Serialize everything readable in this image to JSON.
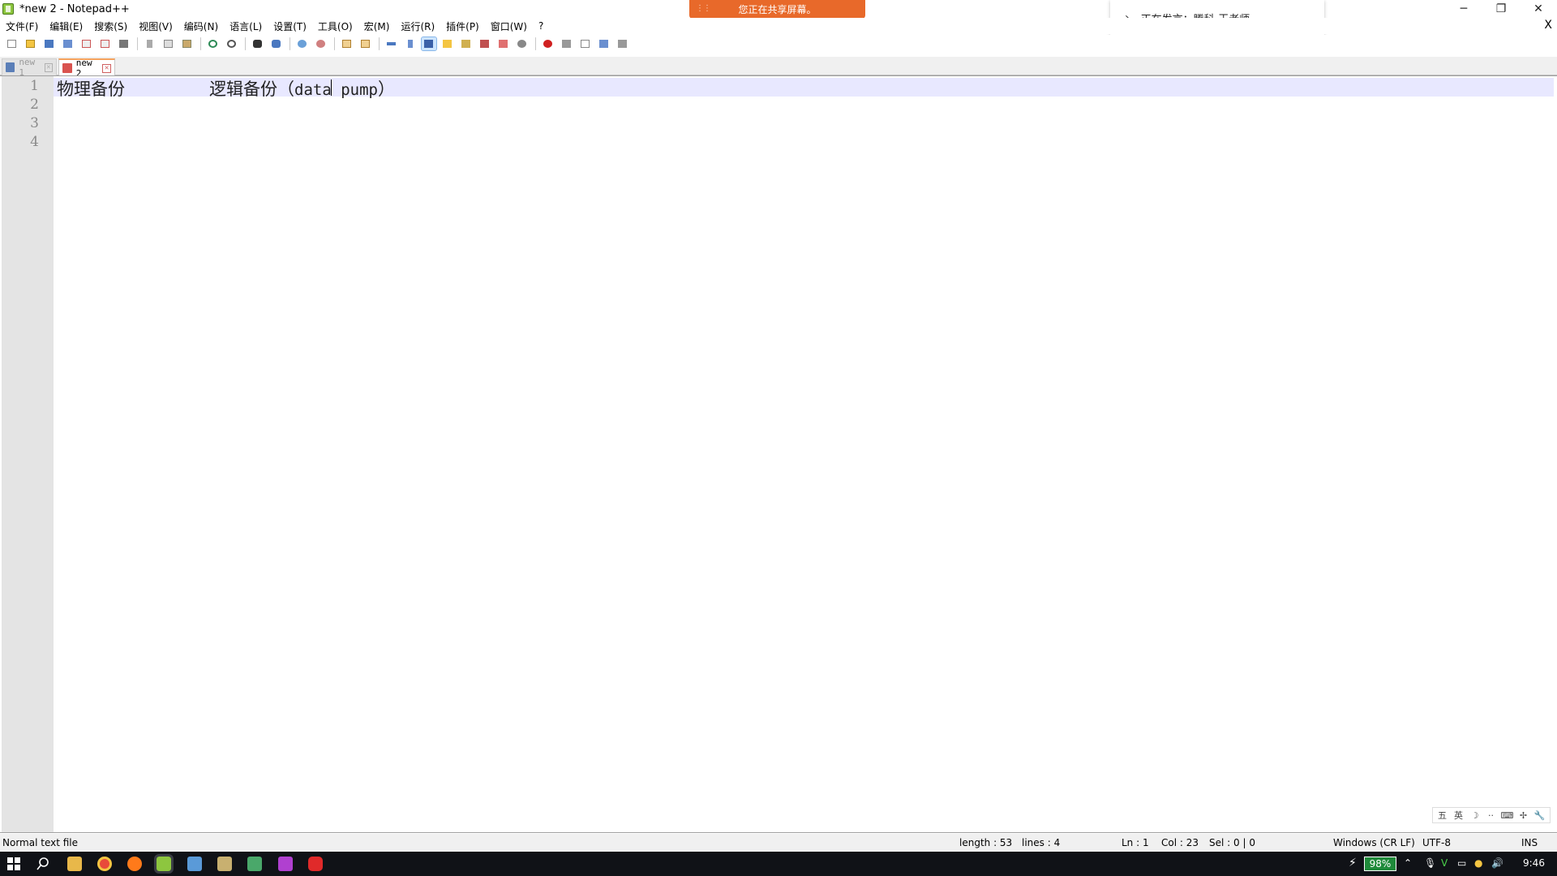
{
  "window": {
    "title": "*new 2 - Notepad++",
    "minimize": "─",
    "restore": "❐",
    "close": "✕"
  },
  "share_banner": {
    "text": "您正在共享屏幕。"
  },
  "speaker": {
    "text": "正在发言：腾科-王老师"
  },
  "menu": {
    "items": [
      "文件(F)",
      "编辑(E)",
      "搜索(S)",
      "视图(V)",
      "编码(N)",
      "语言(L)",
      "设置(T)",
      "工具(O)",
      "宏(M)",
      "运行(R)",
      "插件(P)",
      "窗口(W)",
      "?"
    ],
    "close": "X"
  },
  "tabs": [
    {
      "label": "new 1"
    },
    {
      "label": "new 2"
    }
  ],
  "editor": {
    "line_numbers": [
      "1",
      "2",
      "3",
      "4"
    ],
    "line1": {
      "part1": "物理备份",
      "part2": "逻辑备份（",
      "part3": "data pump",
      "part4": "）"
    }
  },
  "ime": {
    "items": [
      "五",
      "英",
      "☽",
      "··",
      "⌨",
      "✢",
      "🔧"
    ]
  },
  "status": {
    "file_type": "Normal text file",
    "length": "length : 53",
    "lines": "lines : 4",
    "ln": "Ln : 1",
    "col": "Col : 23",
    "sel": "Sel : 0 | 0",
    "eol": "Windows (CR LF)",
    "encoding": "UTF-8",
    "mode": "INS"
  },
  "taskbar": {
    "battery": "98%",
    "time": "9:46"
  },
  "colors": {
    "share_banner": "#e8692a",
    "current_line": "#e8e8ff",
    "taskbar": "#101217"
  }
}
